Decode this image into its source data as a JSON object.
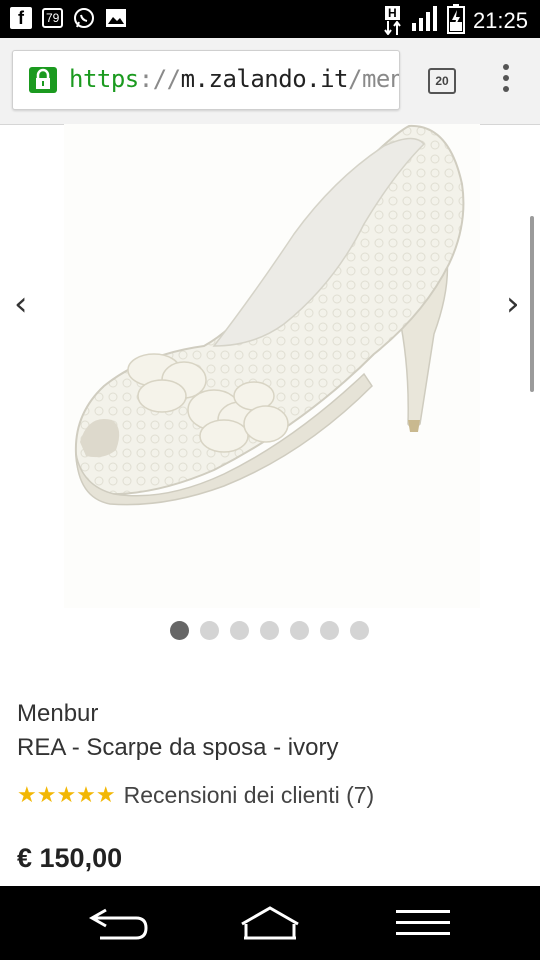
{
  "status_bar": {
    "clock": "21:25",
    "notification_badge": "79",
    "network_label": "H",
    "icons": [
      "facebook-icon",
      "badge-icon",
      "whatsapp-icon",
      "gallery-icon",
      "network-h-icon",
      "signal-icon",
      "battery-charging-icon"
    ]
  },
  "browser": {
    "url_https": "https",
    "url_sep": "://",
    "url_host": "m.zalando.it",
    "url_path": "/menb",
    "tab_count": "20"
  },
  "gallery": {
    "prev_glyph": "‹",
    "next_glyph": "›",
    "image_count": 7,
    "active_index": 0
  },
  "product": {
    "brand": "Menbur",
    "name": "REA - Scarpe da sposa - ivory",
    "stars": "★★★★★",
    "rating": 5,
    "reviews_label": "Recensioni dei clienti (7)",
    "price": "€ 150,00"
  },
  "colors": {
    "accent_green": "#1b9a1f",
    "star_gold": "#f2b705",
    "dot_active": "#666666",
    "dot_inactive": "#d4d4d4"
  }
}
